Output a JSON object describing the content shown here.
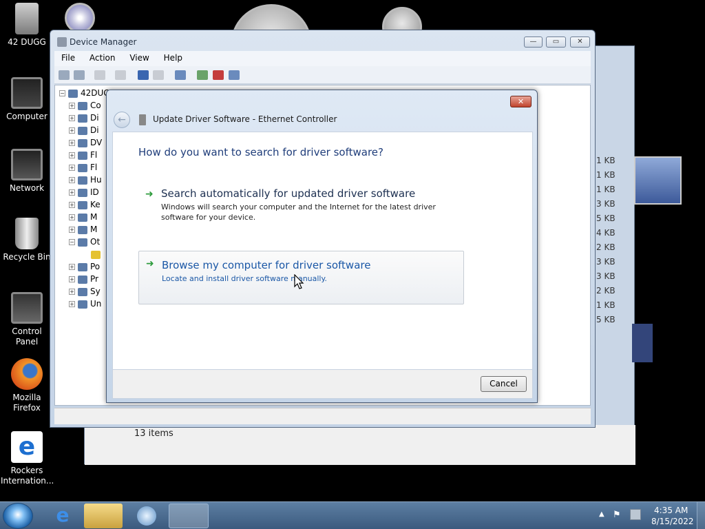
{
  "desktop": {
    "icons": [
      {
        "label": "42 DUGG"
      },
      {
        "label": "Computer"
      },
      {
        "label": "Network"
      },
      {
        "label": "Recycle Bin"
      },
      {
        "label": "Control Panel"
      },
      {
        "label": "Mozilla Firefox"
      },
      {
        "label": "Rockers Internation..."
      }
    ]
  },
  "background_window": {
    "status": "13 items",
    "sizes": [
      "1 KB",
      "1 KB",
      "1 KB",
      "3 KB",
      "5 KB",
      "4 KB",
      "2 KB",
      "3 KB",
      "3 KB",
      "2 KB",
      "1 KB",
      "5 KB"
    ]
  },
  "device_manager": {
    "title": "Device Manager",
    "window_buttons": {
      "minimize": "—",
      "maximize": "▭",
      "close": "✕"
    },
    "menu": [
      "File",
      "Action",
      "View",
      "Help"
    ],
    "tree_root": "42DUGG",
    "tree_items": [
      "Co",
      "Di",
      "Di",
      "DV",
      "Fl",
      "Fl",
      "Hu",
      "ID",
      "Ke",
      "M",
      "M",
      "Ot",
      "",
      "Po",
      "Pr",
      "Sy",
      "Un"
    ]
  },
  "dialog": {
    "title": "Update Driver Software - Ethernet Controller",
    "close_label": "✕",
    "back_icon": "back-arrow-icon",
    "question": "How do you want to search for driver software?",
    "option_auto": {
      "title": "Search automatically for updated driver software",
      "desc": "Windows will search your computer and the Internet for the latest driver software for your device."
    },
    "option_browse": {
      "title": "Browse my computer for driver software",
      "desc": "Locate and install driver software manually."
    },
    "cancel_label": "Cancel"
  },
  "taskbar": {
    "time": "4:35 AM",
    "date": "8/15/2022"
  }
}
